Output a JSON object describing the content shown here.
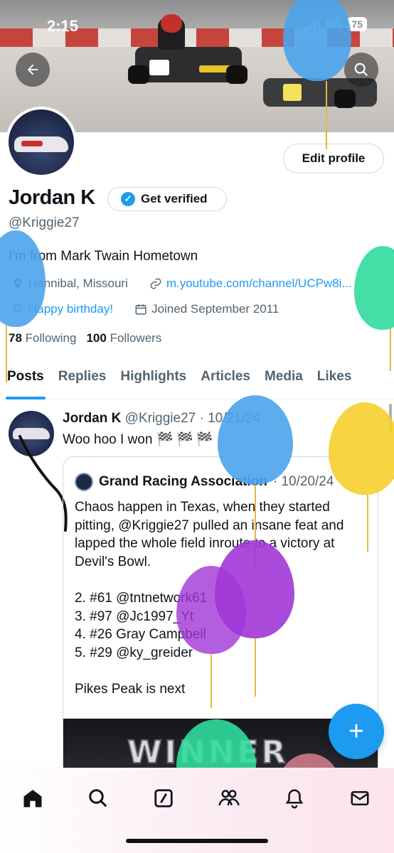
{
  "status_bar": {
    "time": "2:15",
    "network": "5G",
    "battery": "75"
  },
  "profile": {
    "name": "Jordan K",
    "verify_label": "Get verified",
    "handle": "@Kriggie27",
    "bio": "I'm from Mark Twain Hometown",
    "location": "Hannibal, Missouri",
    "website": "m.youtube.com/channel/UCPw8i...",
    "birthday": "Happy birthday!",
    "joined": "Joined September 2011",
    "following_count": "78",
    "following_label": "Following",
    "followers_count": "100",
    "followers_label": "Followers",
    "edit_label": "Edit profile"
  },
  "tabs": [
    {
      "label": "Posts"
    },
    {
      "label": "Replies"
    },
    {
      "label": "Highlights"
    },
    {
      "label": "Articles"
    },
    {
      "label": "Media"
    },
    {
      "label": "Likes"
    }
  ],
  "post": {
    "author": "Jordan K",
    "handle": "@Kriggie27",
    "date": "· 10/21/24",
    "text": "Woo hoo I won",
    "flags": "🏁🏁🏁",
    "quote": {
      "author": "Grand Racing Association",
      "date": "· 10/20/24",
      "body": "Chaos happen in Texas, when they started pitting, @Kriggie27 pulled an insane feat and lapped the whole field inroute to a victory at Devil's Bowl.\n\n2. #61 @tntnetwork61\n3. #97 @Jc1997_Yt\n4. #26 Gray Campbell\n5. #29 @ky_greider\n\nPikes Peak is next",
      "image_text": "WINNER"
    }
  },
  "fab_label": "+",
  "icons": [
    "back-arrow-icon",
    "search-icon",
    "location-icon",
    "link-icon",
    "balloon-icon",
    "calendar-icon",
    "home-icon",
    "grok-icon",
    "communities-icon",
    "notifications-icon",
    "messages-icon"
  ],
  "colors": {
    "accent": "#1d9bf0",
    "text": "#0f1419",
    "muted": "#536471"
  }
}
